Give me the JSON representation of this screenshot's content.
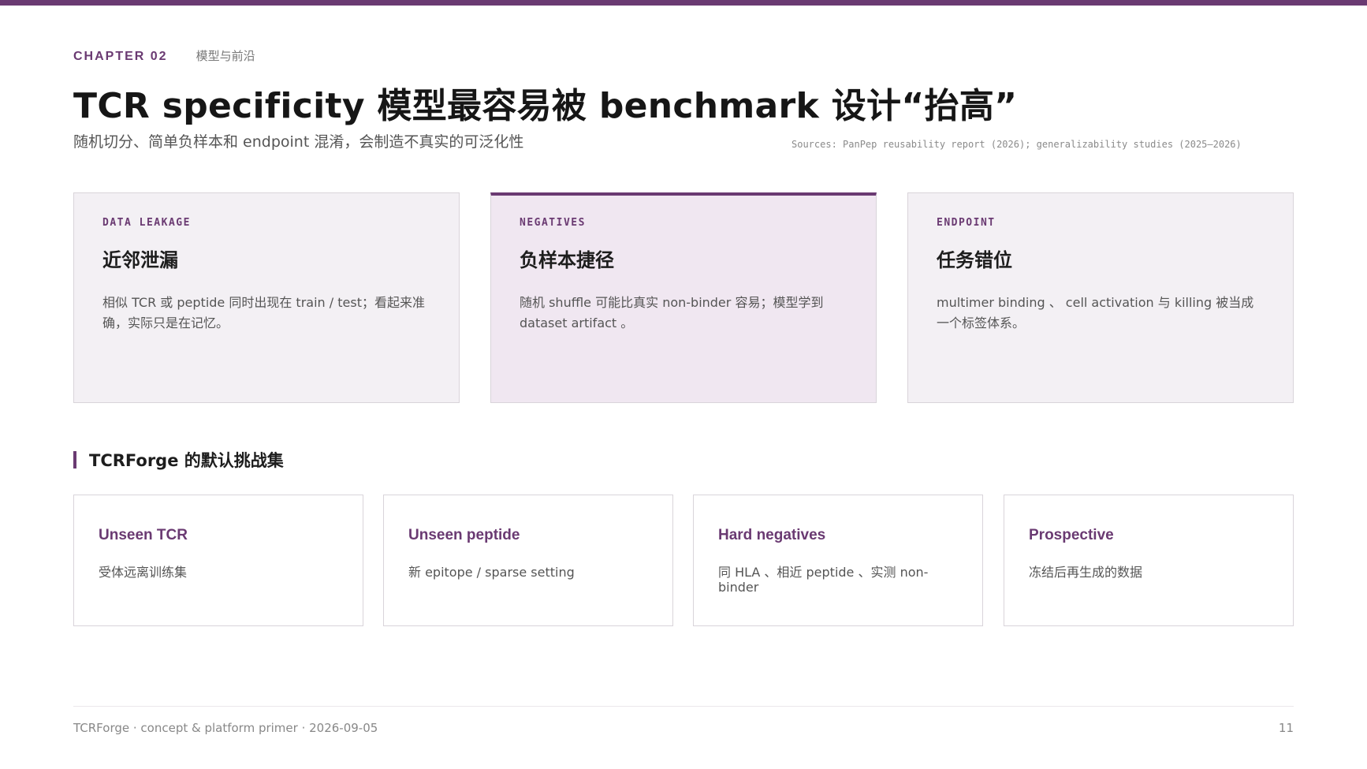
{
  "header": {
    "chapter": "CHAPTER 02",
    "chapter_sub": "模型与前沿",
    "title": "TCR specificity 模型最容易被 benchmark 设计“抬高”",
    "subtitle": "随机切分、简单负样本和 endpoint 混淆，会制造不真实的可泛化性",
    "sources": "Sources: PanPep reusability report (2026); generalizability studies (2025–2026)"
  },
  "cards": [
    {
      "tag": "DATA LEAKAGE",
      "title": "近邻泄漏",
      "body": "相似 TCR 或 peptide 同时出现在 train / test；看起来准确，实际只是在记忆。"
    },
    {
      "tag": "NEGATIVES",
      "title": "负样本捷径",
      "body": "随机 shuffle 可能比真实 non-binder 容易；模型学到 dataset artifact 。"
    },
    {
      "tag": "ENDPOINT",
      "title": "任务错位",
      "body": "multimer binding 、 cell activation 与 killing 被当成一个标签体系。"
    }
  ],
  "section": {
    "title": "TCRForge 的默认挑战集"
  },
  "challenges": [
    {
      "title": "Unseen TCR",
      "desc": "受体远离训练集"
    },
    {
      "title": "Unseen peptide",
      "desc": "新 epitope / sparse setting"
    },
    {
      "title": "Hard negatives",
      "desc": "同 HLA 、相近 peptide 、实测 non-binder"
    },
    {
      "title": "Prospective",
      "desc": "冻结后再生成的数据"
    }
  ],
  "footer": {
    "left": "TCRForge · concept & platform primer · 2026-09-05",
    "page": "11"
  },
  "colors": {
    "accent": "#6a3a72",
    "card_bg": "#f3f0f4",
    "card_highlight_bg": "#f0e7f1"
  }
}
